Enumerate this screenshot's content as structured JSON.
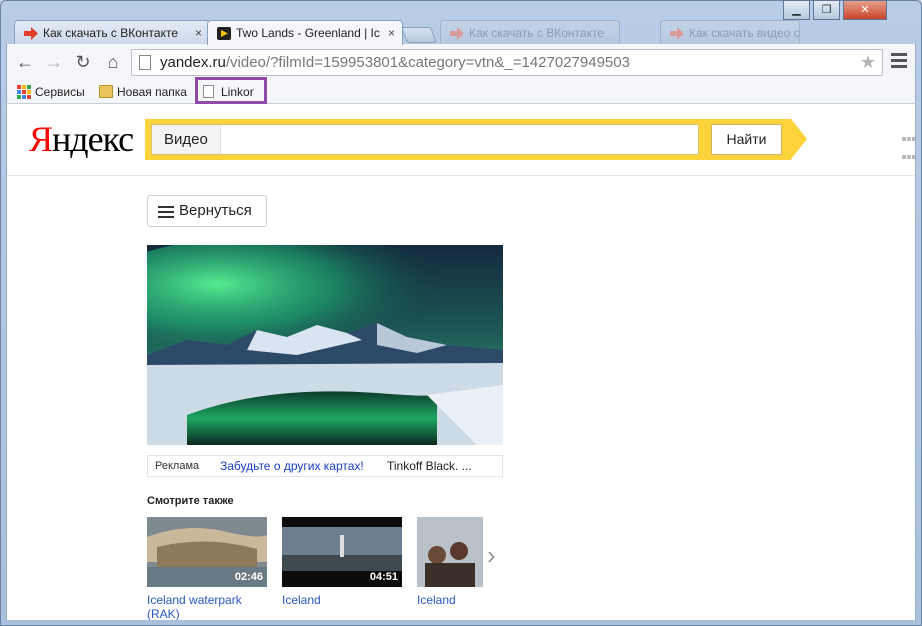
{
  "window": {
    "controls": [
      "▁",
      "❐",
      "✕"
    ]
  },
  "tabs": [
    {
      "title": "Как скачать с ВКонтакте",
      "close": "×",
      "favicon": "red-arrow-icon",
      "active": false
    },
    {
      "title": "Two Lands - Greenland | Ic",
      "close": "×",
      "favicon": "yandex-video-icon",
      "active": true
    },
    {
      "title": "Как скачать с ВКонтакте",
      "close": "",
      "favicon": "red-arrow-icon",
      "active": false
    },
    {
      "title": "Как скачать видео с",
      "close": "",
      "favicon": "red-arrow-icon",
      "active": false
    }
  ],
  "toolbar": {
    "back": "←",
    "forward": "→",
    "reload": "↻",
    "home": "⌂",
    "url_host": "yandex.ru",
    "url_rest": "/video/?filmId=159953801&category=vtn&_=1427027949503",
    "star": "★"
  },
  "bookmarks": [
    {
      "label": "Сервисы",
      "icon": "apps-grid-icon"
    },
    {
      "label": "Новая папка",
      "icon": "folder-icon"
    },
    {
      "label": "Linkor",
      "icon": "page-icon"
    }
  ],
  "yandex": {
    "logo_first": "Я",
    "logo_rest": "ндекс",
    "search_scope": "Видео",
    "search_value": "",
    "search_button": "Найти"
  },
  "page": {
    "back_button": "Вернуться",
    "ad_label": "Реклама",
    "ad_link": "Забудьте о других картах!",
    "ad_text": "Tinkoff Black. ...",
    "see_also": "Смотрите также",
    "next": "›"
  },
  "related": [
    {
      "title": "Iceland waterpark (RAK)",
      "duration": "02:46"
    },
    {
      "title": "Iceland",
      "duration": "04:51"
    },
    {
      "title": "Iceland",
      "duration": ""
    }
  ],
  "colors": {
    "yandex_red": "#ff0000",
    "search_yellow": "#fcd33a",
    "link_blue": "#2a56c6",
    "bookmark_highlight": "#8e4aa6"
  }
}
